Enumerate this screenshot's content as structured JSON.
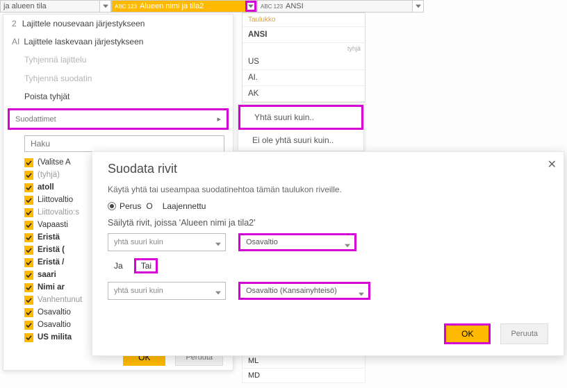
{
  "columns": {
    "c1": "ja alueen tila",
    "c2": "Alueen nimi ja tila2",
    "c3": "ANSI",
    "abc123": "ABC\n123"
  },
  "menu": {
    "sort_asc_prefix": "2",
    "sort_asc": "Lajittele nousevaan järjestykseen",
    "sort_desc_prefix": "AI",
    "sort_desc": "Lajittele laskevaan järjestykseen",
    "clear_sort": "Tyhjennä lajittelu",
    "clear_filter": "Tyhjennä suodatin",
    "remove_empty": "Poista tyhjät",
    "filters": "Suodattimet",
    "search_placeholder": "Haku",
    "ok": "OK",
    "cancel": "Peruuta",
    "items": [
      {
        "label": "(Valitse A",
        "bold": false
      },
      {
        "label": "(tyhjä)",
        "dim": true
      },
      {
        "label": "atoll",
        "bold": true
      },
      {
        "label": "Liittovaltio",
        "bold": false
      },
      {
        "label": "Liittovaltio:s",
        "dim": true
      },
      {
        "label": "Vapaasti",
        "bold": false
      },
      {
        "label": "Eristä",
        "bold": true
      },
      {
        "label": "Eristä (",
        "bold": true
      },
      {
        "label": "Eristä /",
        "bold": true
      },
      {
        "label": "saari",
        "bold": true
      },
      {
        "label": "Nimi ar",
        "bold": true
      },
      {
        "label": "Vanhentunut",
        "dim": true
      },
      {
        "label": "Osavaltio",
        "bold": false
      },
      {
        "label": "Osavaltio",
        "bold": false
      },
      {
        "label": "US milita",
        "bold": true
      }
    ]
  },
  "submenu": {
    "eq": "Yhtä suuri kuin..",
    "neq": "Ei ole yhtä suuri kuin.."
  },
  "ansi": {
    "header": "Taulukko",
    "bold": "ANSI",
    "tail": "tyhjä",
    "rows": [
      "US",
      "AI.",
      "AK"
    ]
  },
  "biglist": [
    "ML",
    "MD"
  ],
  "dialog": {
    "title": "Suodata rivit",
    "subtitle": "Käytä yhtä tai useampaa suodatinehtoa tämän taulukon riveille.",
    "basic": "Perus",
    "advanced": "Laajennettu",
    "keep": "Säilytä rivit, joissa 'Alueen nimi ja tila2'",
    "op": "yhtä suuri kuin",
    "val1": "Osavaltio",
    "and": "Ja",
    "or": "Tai",
    "val2": "Osavaltio (Kansainyhteisö)",
    "ok": "OK",
    "cancel": "Peruuta"
  }
}
